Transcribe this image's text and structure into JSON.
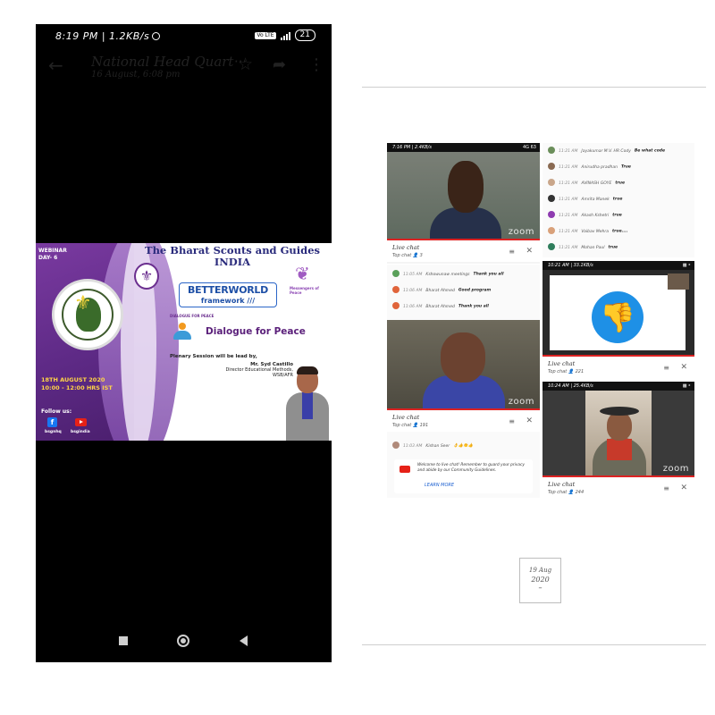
{
  "phone": {
    "status": {
      "time": "8:19 PM | 1.2KB/s",
      "battery": "21",
      "network_badge": "Vo LTE"
    },
    "app_bar": {
      "title": "National Head Quarter",
      "more_title": "···",
      "subtitle": "16 August, 6:08 pm"
    },
    "poster": {
      "webinar": "WEBINAR",
      "day": "DAY- 6",
      "org_line1": "The Bharat Scouts and Guides",
      "org_line2": "INDIA",
      "bw_line1": "BETTERWORLD",
      "bw_line2": "framework ///",
      "messengers": "Messengers of Peace",
      "dfp_small": "DIALOGUE FOR PEACE",
      "dialogue": "Dialogue for Peace",
      "plenary": "Plenary Session will be lead by,",
      "speaker_name": "Mr. Syd Castillo",
      "speaker_role": "Director Educational Methods,",
      "speaker_org": "WSB/AFR",
      "date": "18TH AUGUST 2020",
      "time": "10:00 - 12:00 HRS IST",
      "follow": "Follow us:",
      "handle_fb": "bsgnhq",
      "handle_yt": "bsgindia"
    }
  },
  "collage": {
    "shot1": {
      "status": "7:16 PM | 2.4KB/s",
      "status_right": "4G  63",
      "zoom": "zoom",
      "live_title": "Live chat",
      "live_sub": "Top chat  👤 3"
    },
    "shot2": {
      "messages": [
        {
          "time": "11:21 AM",
          "name": "Jayakumar M.V. HR Cody",
          "text": "Be what code"
        },
        {
          "time": "11:21 AM",
          "name": "Anirudha pradhan",
          "text": "True"
        },
        {
          "time": "11:21 AM",
          "name": "AVINASH GOYE",
          "text": "true"
        },
        {
          "time": "11:21 AM",
          "name": "Amrita Manek",
          "text": "true"
        },
        {
          "time": "11:21 AM",
          "name": "Akash Kshetri",
          "text": "true"
        },
        {
          "time": "11:21 AM",
          "name": "Vaibav Mehra",
          "text": "true...."
        },
        {
          "time": "11:21 AM",
          "name": "Mohan Paul",
          "text": "true"
        }
      ]
    },
    "shot3": {
      "messages": [
        {
          "time": "11:05 AM",
          "name": "Kshowunaw meetings",
          "text": "Thank you all"
        },
        {
          "time": "11:06 AM",
          "name": "Bharat Ahmed",
          "text": "Good program"
        },
        {
          "time": "11:06 AM",
          "name": "Bharat Ahmed",
          "text": "Thank you all"
        }
      ]
    },
    "shot4": {
      "status": "10:21 AM | 33.1KB/s",
      "live_title": "Live chat",
      "live_sub": "Top chat  👤 221"
    },
    "shot5": {
      "zoom": "zoom",
      "live_title": "Live chat",
      "live_sub": "Top chat  👤 191",
      "msg_time": "11:03 AM",
      "msg_name": "Kishan Seer",
      "msg_text": "👌👍👏👍",
      "notice": "Welcome to live chat! Remember to guard your privacy and abide by our Community Guidelines.",
      "learn_more": "LEARN MORE"
    },
    "shot6": {
      "status": "10:24 AM | 25.4KB/s",
      "zoom": "zoom",
      "live_title": "Live chat",
      "live_sub": "Top chat  👤 244"
    }
  },
  "date_box": {
    "day": "19 Aug",
    "year": "2020",
    "dash": "–"
  },
  "colors": {
    "phone_bg": "#000000",
    "poster_purple": "#6b2f8f",
    "live_red": "#dd2222",
    "thumb_blue": "#1e90e6"
  }
}
